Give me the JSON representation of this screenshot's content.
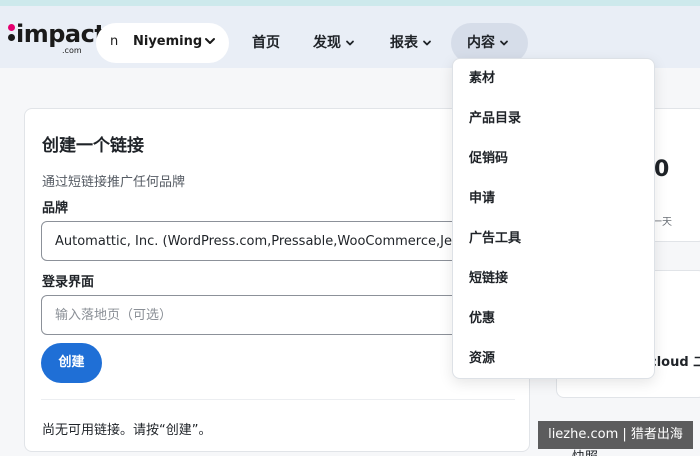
{
  "brand": {
    "logo_text": "impact",
    "logo_sub": ".com"
  },
  "account": {
    "initial": "n",
    "name": "Niyeming"
  },
  "nav": {
    "home": "首页",
    "discover": "发现",
    "reports": "报表",
    "content": "内容"
  },
  "content_menu": {
    "items": [
      {
        "label": "素材"
      },
      {
        "label": "产品目录"
      },
      {
        "label": "促销码"
      },
      {
        "label": "申请"
      },
      {
        "label": "广告工具"
      },
      {
        "label": "短链接"
      },
      {
        "label": "优惠"
      },
      {
        "label": "资源"
      }
    ]
  },
  "create_link": {
    "title": "创建一个链接",
    "subtitle": "通过短链接推广任何品牌",
    "brand_label": "品牌",
    "brand_value": "Automattic, Inc. (WordPress.com,Pressable,WooCommerce,Jetpack)",
    "landing_label": "登录界面",
    "landing_placeholder": "输入落地页（可选）",
    "create_button": "创建",
    "empty_note": "尚无可用链接。请按“创建”。"
  },
  "right_panel": {
    "big_value": "0",
    "small_text": "一天",
    "card2_text": "cloud 二",
    "bottom_text": "快照"
  },
  "watermark": "liezhe.com | 猎者出海",
  "colors": {
    "accent": "#1f6fd6",
    "header_bg": "#e9eef6",
    "logo_pink": "#e4006f"
  }
}
